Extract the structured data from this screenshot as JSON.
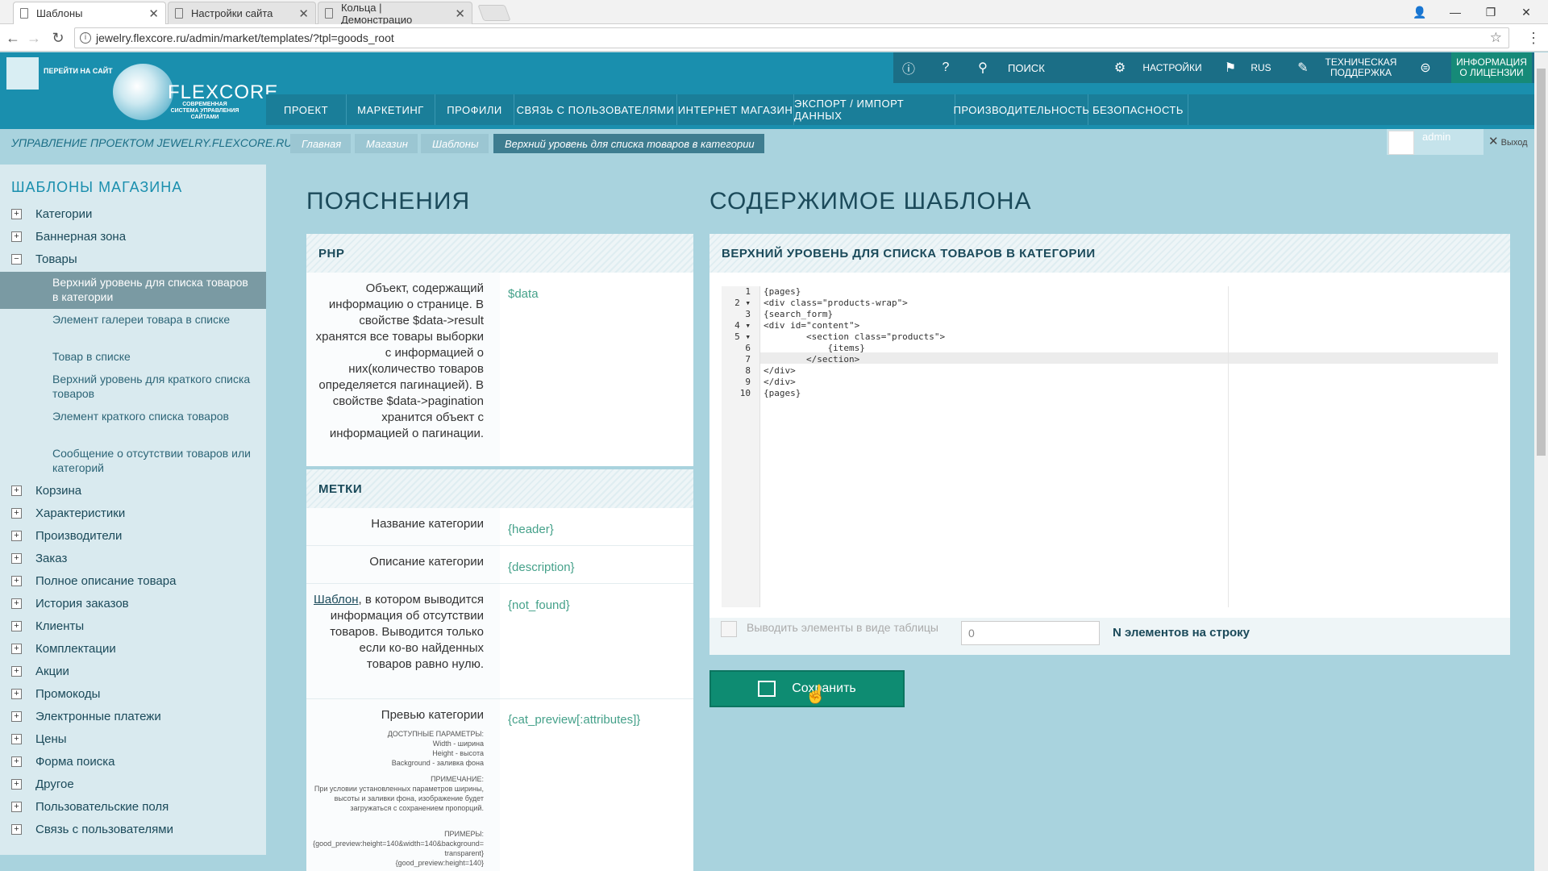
{
  "browser": {
    "tabs": [
      {
        "title": "Шаблоны",
        "active": true
      },
      {
        "title": "Настройки сайта",
        "active": false
      },
      {
        "title": "Кольца | Демонстрацио",
        "active": false
      }
    ],
    "url": "jewelry.flexcore.ru/admin/market/templates/?tpl=goods_root"
  },
  "header": {
    "site_link": "ПЕРЕЙТИ НА САЙТ",
    "logo": "FLEXCORE",
    "logo_sub": "СОВРЕМЕННАЯ СИСТЕМА УПРАВЛЕНИЯ САЙТАМИ",
    "search_placeholder": "ПОИСК",
    "settings": "НАСТРОЙКИ",
    "lang": "RUS",
    "support": "ТЕХНИЧЕСКАЯ ПОДДЕРЖКА",
    "license": "ИНФОРМАЦИЯ О ЛИЦЕНЗИИ",
    "menu": [
      "ПРОЕКТ",
      "МАРКЕТИНГ",
      "ПРОФИЛИ",
      "СВЯЗЬ С ПОЛЬЗОВАТЕЛЯМИ",
      "ИНТЕРНЕТ МАГАЗИН",
      "ЭКСПОРТ / ИМПОРТ ДАННЫХ",
      "ПРОИЗВОДИТЕЛЬНОСТЬ",
      "БЕЗОПАСНОСТЬ"
    ]
  },
  "breadcrumb": {
    "project": "УПРАВЛЕНИЕ ПРОЕКТОМ JEWELRY.FLEXCORE.RU",
    "items": [
      "Главная",
      "Магазин",
      "Шаблоны",
      "Верхний уровень для списка товаров в категории"
    ],
    "user": "admin",
    "logout": "Выход"
  },
  "sidebar": {
    "title": "ШАБЛОНЫ МАГАЗИНА",
    "items_top": [
      "Категории",
      "Баннерная зона"
    ],
    "expanded": "Товары",
    "sub_items": [
      "Верхний уровень для списка товаров в категории",
      "Элемент галереи товара в списке",
      "Товар в списке",
      "Верхний уровень для краткого списка товаров",
      "Элемент краткого списка товаров",
      "Сообщение о отсутствии товаров или категорий"
    ],
    "items_bottom": [
      "Корзина",
      "Характеристики",
      "Производители",
      "Заказ",
      "Полное описание товара",
      "История заказов",
      "Клиенты",
      "Комплектации",
      "Акции",
      "Промокоды",
      "Электронные платежи",
      "Цены",
      "Форма поиска",
      "Другое",
      "Пользовательские поля",
      "Связь с пользователями"
    ]
  },
  "left_panel": {
    "title": "ПОЯСНЕНИЯ",
    "php_head": "PHP",
    "php_desc": "Объект, содержащий информацию о странице. В свойстве $data->result хранятся все товары выборки с информацией о них(количество товаров определяется пагинацией). В свойстве $data->pagination хранится объект с информацией о пагинации.",
    "php_var": "$data",
    "tags_head": "МЕТКИ",
    "tags": [
      {
        "desc": "Название категории",
        "val": "{header}"
      },
      {
        "desc": "Описание категории",
        "val": "{description}"
      },
      {
        "link": "Шаблон",
        "desc": ", в котором выводится информация об отсутствии товаров. Выводится только если ко-во найденных товаров равно нулю.",
        "val": "{not_found}"
      },
      {
        "desc": "Превью категории",
        "val": "{cat_preview[:attributes]}"
      }
    ],
    "preview_params": "ДОСТУПНЫЕ ПАРАМЕТРЫ:\nWidth - ширина\nHeight - высота\nBackground - заливка фона",
    "preview_note": "ПРИМЕЧАНИЕ:\nПри условии установленных параметров ширины, высоты и заливки фона, изображение будет загружаться с сохранением пропорций.",
    "preview_examples": "ПРИМЕРЫ:\n{good_preview:height=140&width=140&background=transparent}\n{good_preview:height=140}"
  },
  "right_panel": {
    "title": "СОДЕРЖИМОЕ ШАБЛОНА",
    "head": "ВЕРХНИЙ УРОВЕНЬ ДЛЯ СПИСКА ТОВАРОВ В КАТЕГОРИИ",
    "code_lines": [
      "{pages}",
      "<div class=\"products-wrap\">",
      "{search_form}",
      "<div id=\"content\">",
      "        <section class=\"products\">",
      "            {items}",
      "        </section>",
      "</div>",
      "</div>",
      "{pages}"
    ],
    "table_checkbox_label": "Выводить элементы в виде таблицы",
    "n_value": "0",
    "n_label": "N элементов на строку",
    "save": "Сохранить"
  }
}
